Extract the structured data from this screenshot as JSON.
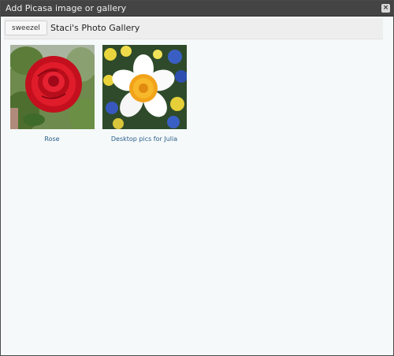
{
  "window": {
    "title": "Add Picasa image or gallery",
    "close_symbol": "×"
  },
  "toolbar": {
    "user_button_label": "sweezel",
    "gallery_title": "Staci's Photo Gallery"
  },
  "albums": [
    {
      "caption": "Rose",
      "thumbnail_icon": "red-rose-photo"
    },
    {
      "caption": "Desktop pics for Julia",
      "thumbnail_icon": "daffodil-flowers-photo"
    }
  ],
  "colors": {
    "titlebar": "#444444",
    "background": "#f5f9fa",
    "link": "#2b5f8a"
  }
}
